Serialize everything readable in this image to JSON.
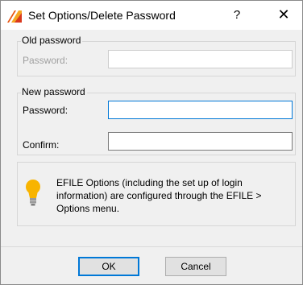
{
  "window": {
    "title": "Set Options/Delete Password",
    "help_glyph": "?",
    "close_glyph": "✕"
  },
  "old_password": {
    "group_title": "Old password",
    "password_label": "Password:",
    "password_value": ""
  },
  "new_password": {
    "group_title": "New password",
    "password_label": "Password:",
    "password_value": "",
    "confirm_label": "Confirm:",
    "confirm_value": ""
  },
  "info": {
    "icon": "lightbulb-icon",
    "text": "EFILE Options (including the set up of login information) are configured through the EFILE > Options menu."
  },
  "buttons": {
    "ok_label": "OK",
    "cancel_label": "Cancel"
  },
  "colors": {
    "accent": "#0078d7",
    "dialog_bg": "#f0f0f0",
    "disabled_text": "#a0a0a0"
  }
}
